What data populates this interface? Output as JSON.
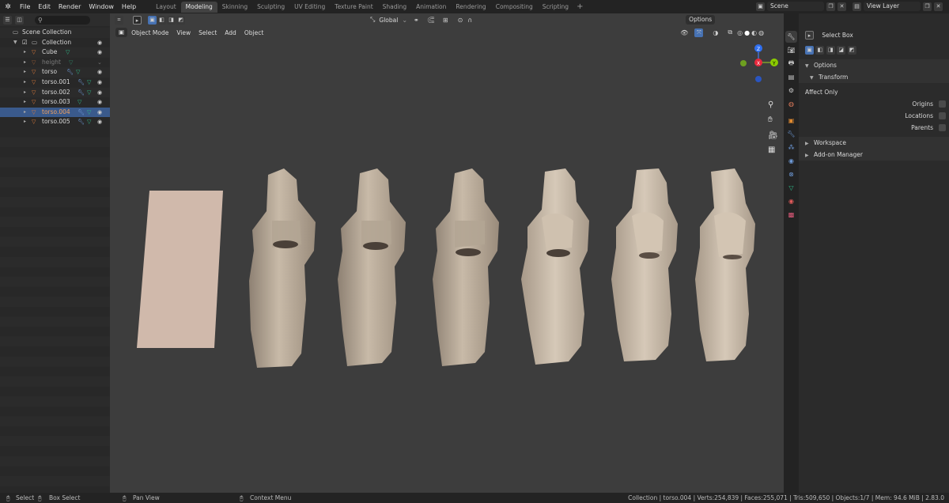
{
  "menu": [
    "File",
    "Edit",
    "Render",
    "Window",
    "Help"
  ],
  "workspaces": [
    "Layout",
    "Modeling",
    "Skinning",
    "Sculpting",
    "UV Editing",
    "Texture Paint",
    "Shading",
    "Animation",
    "Rendering",
    "Compositing",
    "Scripting"
  ],
  "active_workspace": "Modeling",
  "scene": {
    "label": "Scene"
  },
  "view_layer": {
    "label": "View Layer"
  },
  "outliner": {
    "root": "Scene Collection",
    "collection": "Collection",
    "items": [
      {
        "name": "Cube"
      },
      {
        "name": "height"
      },
      {
        "name": "torso"
      },
      {
        "name": "torso.001"
      },
      {
        "name": "torso.002"
      },
      {
        "name": "torso.003"
      },
      {
        "name": "torso.004"
      },
      {
        "name": "torso.005"
      }
    ]
  },
  "viewport": {
    "transform_orientation": "Global",
    "options": "Options",
    "mode": "Object Mode",
    "menu": [
      "View",
      "Select",
      "Add",
      "Object"
    ],
    "gizmo": {
      "x": "X",
      "y": "Y",
      "z": "Z"
    }
  },
  "properties": {
    "tool": "Select Box",
    "options": "Options",
    "transform": "Transform",
    "affect_only": "Affect Only",
    "checks": [
      "Origins",
      "Locations",
      "Parents"
    ],
    "workspace": "Workspace",
    "addon_manager": "Add-on Manager"
  },
  "status": {
    "select": "Select",
    "box_select": "Box Select",
    "pan_view": "Pan View",
    "context_menu": "Context Menu",
    "stats": "Collection | torso.004 | Verts:254,839 | Faces:255,071 | Tris:509,650 | Objects:1/7 | Mem: 94.6 MiB | 2.83.0"
  },
  "colors": {
    "accent": "#4772b3",
    "mesh": "#b9ab9a",
    "object_icon": "#e07b39",
    "data_icon": "#2ebc8a"
  }
}
